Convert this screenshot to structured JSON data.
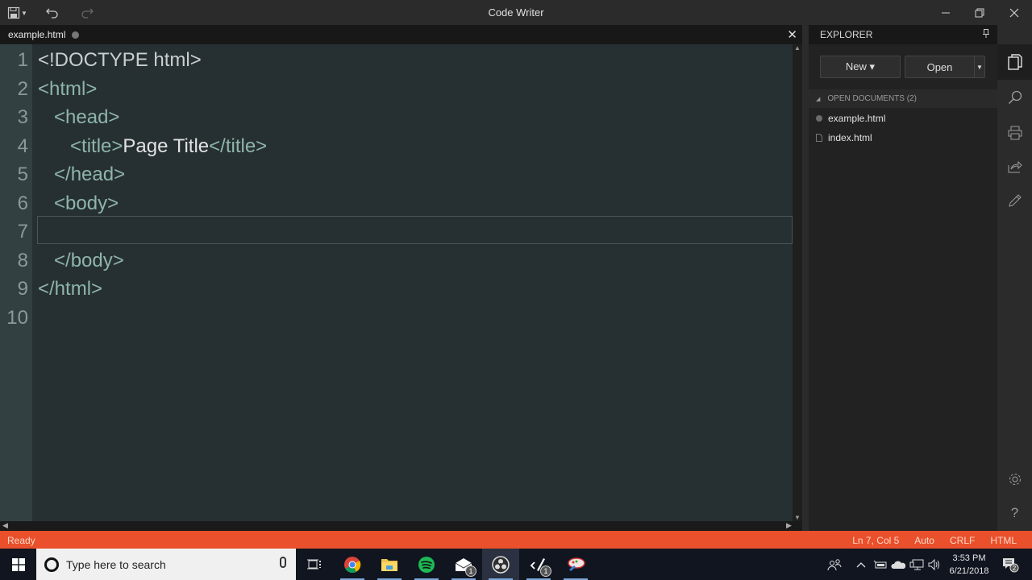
{
  "app": {
    "title": "Code Writer",
    "toolbar_icons": [
      "save-icon",
      "undo-icon",
      "redo-icon"
    ]
  },
  "window_controls": [
    "minimize",
    "restore",
    "close"
  ],
  "tabs": [
    {
      "label": "example.html",
      "modified": true
    }
  ],
  "editor": {
    "current_line": 7,
    "lines": [
      {
        "n": "1",
        "indent": "",
        "parts": [
          {
            "t": "<!DOCTYPE html>",
            "c": "doc"
          }
        ]
      },
      {
        "n": "2",
        "indent": "",
        "parts": [
          {
            "t": "<html>",
            "c": "tag"
          }
        ]
      },
      {
        "n": "3",
        "indent": "   ",
        "parts": [
          {
            "t": "<head>",
            "c": "tag"
          }
        ]
      },
      {
        "n": "4",
        "indent": "      ",
        "parts": [
          {
            "t": "<title>",
            "c": "tag"
          },
          {
            "t": "Page Title",
            "c": "txt"
          },
          {
            "t": "</title>",
            "c": "tag"
          }
        ]
      },
      {
        "n": "5",
        "indent": "   ",
        "parts": [
          {
            "t": "</head>",
            "c": "tag"
          }
        ]
      },
      {
        "n": "6",
        "indent": "   ",
        "parts": [
          {
            "t": "<body>",
            "c": "tag"
          }
        ]
      },
      {
        "n": "7",
        "indent": "",
        "parts": []
      },
      {
        "n": "8",
        "indent": "   ",
        "parts": [
          {
            "t": "</body>",
            "c": "tag"
          }
        ]
      },
      {
        "n": "9",
        "indent": "",
        "parts": [
          {
            "t": "</html>",
            "c": "tag"
          }
        ]
      },
      {
        "n": "10",
        "indent": "",
        "parts": []
      }
    ]
  },
  "explorer": {
    "title": "EXPLORER",
    "new_label": "New ▾",
    "open_label": "Open",
    "open_dropdown": "▼",
    "section_label": "OPEN DOCUMENTS (2)",
    "documents": [
      {
        "name": "example.html",
        "icon": "modified-dot-icon"
      },
      {
        "name": "index.html",
        "icon": "file-icon"
      }
    ]
  },
  "sidebar_icons": [
    "documents-icon",
    "search-icon",
    "print-icon",
    "share-icon",
    "edit-icon",
    "settings-icon",
    "help-icon"
  ],
  "status": {
    "left": "Ready",
    "position": "Ln 7, Col 5",
    "encoding": "Auto",
    "line_ending": "CRLF",
    "language": "HTML",
    "bg_color": "#e9502b"
  },
  "taskbar": {
    "search_placeholder": "Type here to search",
    "apps": [
      {
        "name": "task-view",
        "badge": null
      },
      {
        "name": "chrome",
        "badge": null
      },
      {
        "name": "file-explorer",
        "badge": null
      },
      {
        "name": "spotify",
        "badge": null
      },
      {
        "name": "mail",
        "badge": "1"
      },
      {
        "name": "obs",
        "badge": null
      },
      {
        "name": "code-writer",
        "badge": "1"
      },
      {
        "name": "paint",
        "badge": null
      }
    ],
    "time": "3:53 PM",
    "date": "6/21/2018",
    "notifications": "2"
  }
}
